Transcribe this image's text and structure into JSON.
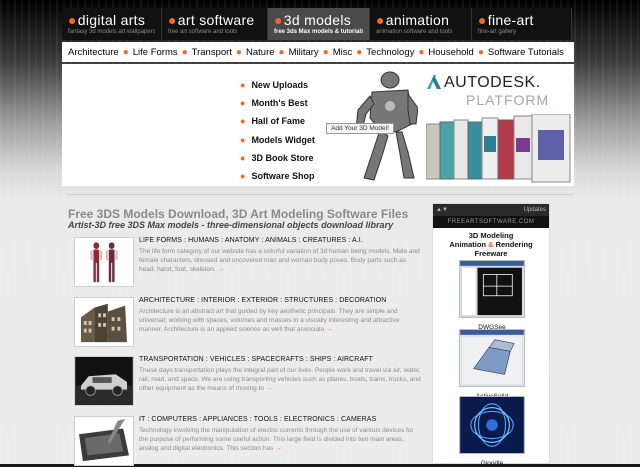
{
  "tabs": [
    {
      "label": "digital arts",
      "sub": "fantasy 3d models art wallpapers"
    },
    {
      "label": "art software",
      "sub": "free art software and tools"
    },
    {
      "label": "3d models",
      "sub": "free 3ds Max models & tutorials"
    },
    {
      "label": "animation",
      "sub": "animation software and tools"
    },
    {
      "label": "fine-art",
      "sub": "fine-art gallery"
    }
  ],
  "nav": [
    "Architecture",
    "Life Forms",
    "Transport",
    "Nature",
    "Military",
    "Misc",
    "Technology",
    "Household",
    "Software Tutorials"
  ],
  "banner": {
    "menu": [
      "New Uploads",
      "Month's Best",
      "Hall of Fame",
      "Models Widget",
      "3D Book Store",
      "Software Shop"
    ],
    "add_model": "Add Your 3D Model!",
    "autodesk_logo": "AUTODESK.",
    "autodesk_platform": "PLATFORM"
  },
  "main": {
    "title": "Free 3DS Models Download, 3D Art Modeling Software Files",
    "subtitle": "Artist-3D free 3DS Max models - three-dimensional objects download library",
    "categories": [
      {
        "heading": "LIFE FORMS : HUMANS : ANATOMY : ANIMALS : CREATURES : A.I.",
        "desc": "The life form category of our website has a colorful variation of 3d human being models. Male and female characters, dressed and uncovered man and woman body poses. Body parts such as head, hand, foot, skeleton.",
        "arrow": "→"
      },
      {
        "heading": "ARCHITECTURE : INTERIOR : EXTERIOR : STRUCTURES : DECORATION",
        "desc": "Architecture is an abstract art that guided by key aesthetic principals. They are simple and universal; working with spaces, volumes and masses in a visually interesting and attractive manner. Architecture is an applied science as well that associate",
        "arrow": "→"
      },
      {
        "heading": "TRANSPORTATION : VEHICLES : SPACECRAFTS : SHIPS : AIRCRAFT",
        "desc": "These days transportation plays the integral part of our lives. People work and travel via air, water, rail, road, and space. We are using transporting vehicles such as planes, boats, trains, trucks, and other equipment as the means of moving to",
        "arrow": "→"
      },
      {
        "heading": "IT : COMPUTERS : APPLIANCES : TOOLS : ELECTRONICS : CAMERAS",
        "desc": "Technology involving the manipulation of electric currents through the use of various devices for the purpose of performing some useful action. This large field is divided into two main areas, analog and digital electronics. This section has",
        "arrow": "→"
      }
    ]
  },
  "sidebar": {
    "top_left": "▲▼",
    "top_right": "Updates",
    "brand": "FREEARTSOFTWARE.COM",
    "heading_1": "3D Modeling",
    "heading_2a": "Animation ",
    "heading_amp": "&",
    "heading_2b": " Rendering",
    "heading_3": "Freeware",
    "software": [
      "DWGSee",
      "ActiveSolid",
      "Gloodle"
    ]
  },
  "colors": {
    "accent": "#f26722",
    "tab_bg": "#111111",
    "tab_active": "#4a4a4a"
  }
}
